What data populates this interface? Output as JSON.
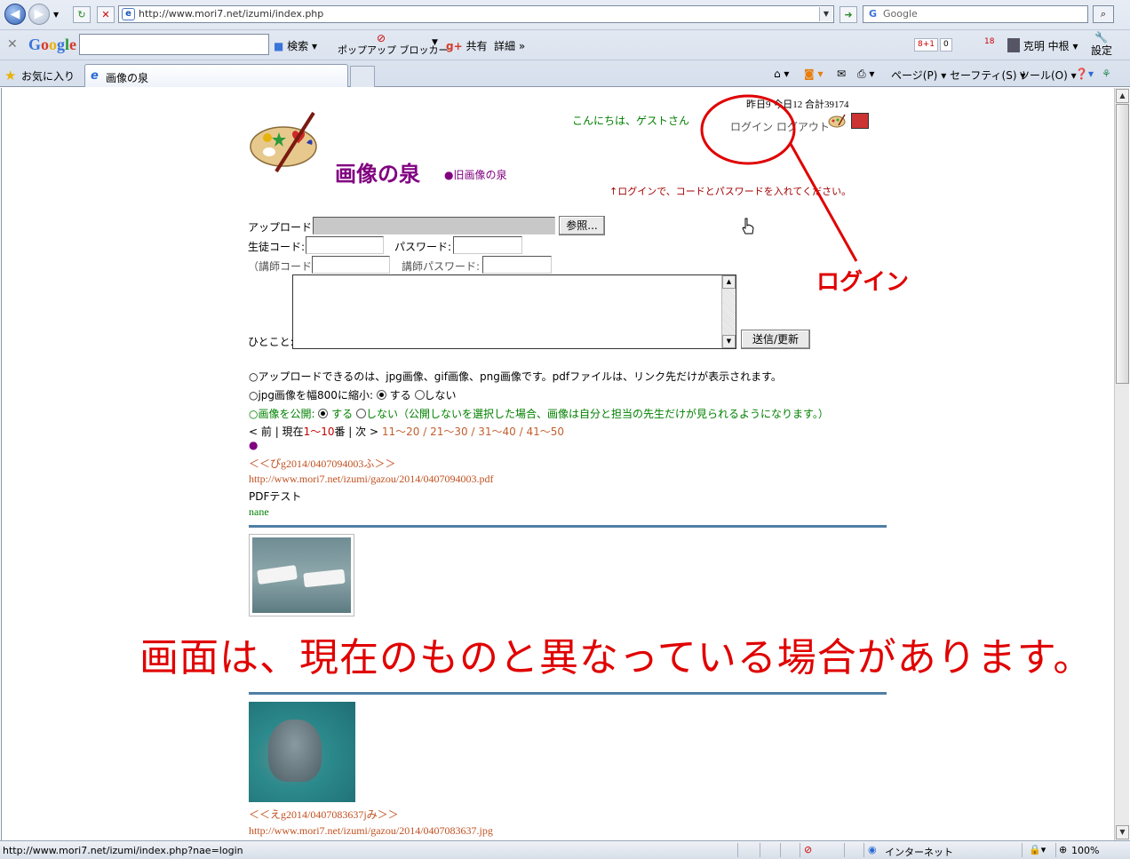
{
  "browser": {
    "address": "http://www.mori7.net/izumi/index.php",
    "search_placeholder": "Google",
    "toolbar": {
      "google_search": "検索",
      "popup_blocker": "ポップアップ ブロッカー",
      "share": "共有",
      "details": "詳細",
      "count1": "8+1",
      "count2": "0",
      "notif": "18",
      "user": "克明 中根",
      "settings": "設定"
    },
    "favorites": "お気に入り",
    "tab_title": "画像の泉",
    "commands": {
      "page": "ページ(P)",
      "safety": "セーフティ(S)",
      "tools": "ツール(O)"
    },
    "status_url": "http://www.mori7.net/izumi/index.php?nae=login",
    "status_zone": "インターネット",
    "status_zoom": "100%"
  },
  "page": {
    "counter": "昨日9 今日12 合計39174",
    "greeting": "こんにちは、ゲストさん",
    "login_links": "ログイン ログアウト",
    "title": "画像の泉",
    "old_link": "●旧画像の泉",
    "login_hint": "↑ログインで、コードとパスワードを入れてください。",
    "form": {
      "upload_label": "アップロード:",
      "browse_button": "参照...",
      "student_code_label": "生徒コード:",
      "password_label": "パスワード:",
      "teacher_code_label": "（講師コード:",
      "teacher_password_label": "講師パスワード:",
      "comment_label": "ひとこと:",
      "submit_button": "送信/更新"
    },
    "notes": {
      "upload_types": "○アップロードできるのは、jpg画像、gif画像、png画像です。pdfファイルは、リンク先だけが表示されます。",
      "shrink_label": "○jpg画像を幅800に縮小:",
      "yes": "する",
      "no": "しない",
      "public_label": "○画像を公開:",
      "public_no_note": "しない（公開しないを選択した場合、画像は自分と担当の先生だけが見られるようになります。）"
    },
    "pager": {
      "prev": "< 前",
      "current_prefix": "現在",
      "current_range": "1〜10",
      "current_suffix": "番",
      "next": "次 >",
      "next_pages": "11〜20 / 21〜30 / 31〜40 / 41〜50"
    },
    "bullet": "●",
    "entries": [
      {
        "title": "＜＜ぴg2014/0407094003ふ＞＞",
        "url": "http://www.mori7.net/izumi/gazou/2014/0407094003.pdf",
        "text": "PDFテスト",
        "name": "nane"
      },
      {
        "title": "＜＜えg2014/0407083637jみ＞＞",
        "url": "http://www.mori7.net/izumi/gazou/2014/0407083637.jpg"
      }
    ]
  },
  "annotations": {
    "login_callout": "ログイン",
    "notice": "画面は、現在のものと異なっている場合があります。",
    "color": "#e00000"
  }
}
